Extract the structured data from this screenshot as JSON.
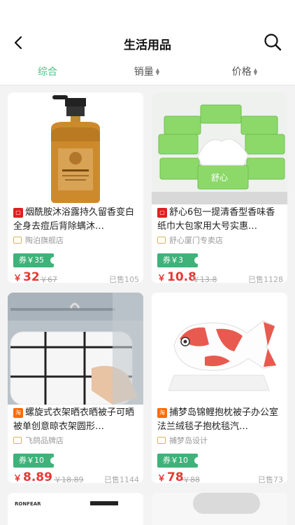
{
  "header": {
    "title": "生活用品"
  },
  "sortbar": {
    "tabs": [
      "综合",
      "销量",
      "价格"
    ]
  },
  "products": [
    {
      "badge": "天猫",
      "name": "烟酰胺沐浴露持久留香变白全身去痘后背除螨沐…",
      "shop": "陶泊旗舰店",
      "coupon": "券￥35",
      "price": "32",
      "original": "￥67",
      "sold": "已售105"
    },
    {
      "badge": "天猫",
      "name": "舒心6包一提清香型香味香纸巾大包家用大号实惠…",
      "shop": "舒心厦门专卖店",
      "coupon": "券￥3",
      "price": "10.8",
      "original": "￥13.8",
      "sold": "已售1128"
    },
    {
      "badge": "淘",
      "name": "螺旋式衣架晒衣晒被子可晒被单创意晾衣架圆形…",
      "shop": "飞鸽品牌店",
      "coupon": "券￥10",
      "price": "8.89",
      "original": "￥18.89",
      "sold": "已售1144"
    },
    {
      "badge": "淘",
      "name": "捕梦岛锦鲤抱枕被子办公室法兰绒毯子抱枕毯汽…",
      "shop": "捕梦岛设计",
      "coupon": "券￥10",
      "price": "78",
      "original": "￥88",
      "sold": "已售73"
    }
  ],
  "partial": {
    "brand5": "RONFEAR"
  },
  "colors": {
    "accent": "#4cbf86",
    "price": "#e53935",
    "coupon": "#3fb27a"
  },
  "icons": {
    "back": "chevron-left-icon",
    "search": "search-icon"
  }
}
